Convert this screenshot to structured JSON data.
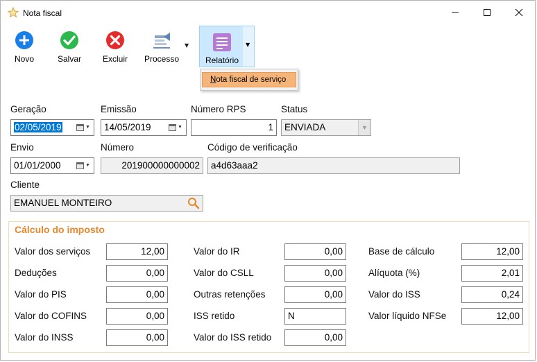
{
  "window": {
    "title": "Nota fiscal",
    "minimize_glyph": "─",
    "maximize_glyph": "☐",
    "close_glyph": "✕"
  },
  "toolbar": {
    "novo": "Novo",
    "salvar": "Salvar",
    "excluir": "Excluir",
    "processo": "Processo",
    "relatorio": "Relatório",
    "caret": "▼"
  },
  "report_menu": {
    "item_first_letter": "N",
    "item_rest": "ota fiscal de serviço"
  },
  "form": {
    "geracao_label": "Geração",
    "geracao_value": "02/05/2019",
    "emissao_label": "Emissão",
    "emissao_value": "14/05/2019",
    "numero_rps_label": "Número RPS",
    "numero_rps_value": "1",
    "status_label": "Status",
    "status_value": "ENVIADA",
    "envio_label": "Envio",
    "envio_value": "01/01/2000",
    "numero_label": "Número",
    "numero_value": "201900000000002",
    "codigo_label": "Código de verificação",
    "codigo_value": "a4d63aaa2",
    "cliente_label": "Cliente",
    "cliente_value": "EMANUEL MONTEIRO"
  },
  "tax": {
    "title": "Cálculo do imposto",
    "col1": [
      {
        "label": "Valor dos serviços",
        "value": "12,00"
      },
      {
        "label": "Deduções",
        "value": "0,00"
      },
      {
        "label": "Valor do PIS",
        "value": "0,00"
      },
      {
        "label": "Valor do COFINS",
        "value": "0,00"
      },
      {
        "label": "Valor do INSS",
        "value": "0,00"
      }
    ],
    "col2": [
      {
        "label": "Valor do IR",
        "value": "0,00"
      },
      {
        "label": "Valor do CSLL",
        "value": "0,00"
      },
      {
        "label": "Outras retenções",
        "value": "0,00"
      },
      {
        "label": "ISS retido",
        "value": "N"
      },
      {
        "label": "Valor do ISS retido",
        "value": "0,00"
      }
    ],
    "col3": [
      {
        "label": "Base de cálculo",
        "value": "12,00"
      },
      {
        "label": "Alíquota (%)",
        "value": "2,01"
      },
      {
        "label": "Valor do ISS",
        "value": "0,24"
      },
      {
        "label": "Valor líquido NFSe",
        "value": "12,00"
      }
    ]
  },
  "colors": {
    "accent_orange": "#e8872b",
    "menu_highlight": "#f5b57a",
    "ribbon_active": "#cce8ff",
    "selection_blue": "#0078d7"
  }
}
